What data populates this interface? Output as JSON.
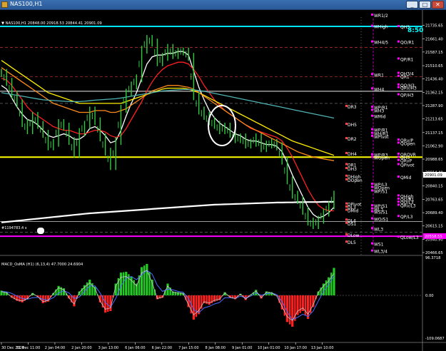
{
  "window": {
    "title": "NAS100,H1",
    "buttons": [
      "_",
      "□",
      "✕"
    ]
  },
  "chart_info": {
    "symbol_line": "▼ NAS100,H1  20848.00 20918.53 20844.41 20901.09",
    "clock": "8:50",
    "macd_label": "MACD_OsMA (H1) (6,13,4)  47.7000 24.6904",
    "chart_note": "#1194783.4 s"
  },
  "price_scale": [
    {
      "label": "21735.65",
      "price": 21735.65
    },
    {
      "label": "21661.40",
      "price": 21661.4
    },
    {
      "label": "21587.15",
      "price": 21587.15
    },
    {
      "label": "21510.65",
      "price": 21510.65
    },
    {
      "label": "21436.40",
      "price": 21436.4
    },
    {
      "label": "21362.15",
      "price": 21362.15
    },
    {
      "label": "21287.90",
      "price": 21287.9
    },
    {
      "label": "21213.65",
      "price": 21213.65
    },
    {
      "label": "21137.15",
      "price": 21137.15
    },
    {
      "label": "21062.90",
      "price": 21062.9
    },
    {
      "label": "20988.65",
      "price": 20988.65
    },
    {
      "label": "20914.40",
      "price": 20914.4
    },
    {
      "label": "20840.15",
      "price": 20840.15
    },
    {
      "label": "20763.65",
      "price": 20763.65
    },
    {
      "label": "20689.40",
      "price": 20689.4
    },
    {
      "label": "20615.15",
      "price": 20615.15
    },
    {
      "label": "20540.90",
      "price": 20540.9
    },
    {
      "label": "20466.65",
      "price": 20466.65
    }
  ],
  "price_badges": [
    {
      "label": "20901.09",
      "price": 20901.09,
      "color": "#ffffff",
      "text_color": "#000000"
    },
    {
      "label": "20558.55",
      "price": 20558.55,
      "color": "#ff00ff",
      "text_color": "#ffffff"
    }
  ],
  "macd_scale": [
    {
      "label": "96.3718",
      "value": 96.3718
    },
    {
      "label": "0.00",
      "value": 0
    },
    {
      "label": "-109.0687",
      "value": -109.0687
    }
  ],
  "time_labels": [
    "30 Dec 2024",
    "31 Dec 11:00",
    "2 Jan 04:00",
    "2 Jan 20:00",
    "3 Jan 13:00",
    "6 Jan 06:00",
    "6 Jan 22:00",
    "7 Jan 15:00",
    "8 Jan 08:00",
    "9 Jan 01:00",
    "10 Jan 01:00",
    "10 Jan 17:00",
    "13 Jan 10:00"
  ],
  "level_labels_left": [
    {
      "text": "DR3",
      "price": 21280,
      "color": "#ffffff"
    },
    {
      "text": "DH5",
      "price": 21180,
      "color": "#ffffff"
    },
    {
      "text": "DR2",
      "price": 21100,
      "color": "#ffffff"
    },
    {
      "text": "DH4",
      "price": 21017,
      "color": "#ffffff"
    },
    {
      "text": "DR1",
      "price": 20955,
      "color": "#ffffff"
    },
    {
      "text": "DH3",
      "price": 20933,
      "color": "#ffffff"
    },
    {
      "text": "DHigh",
      "price": 20890,
      "color": "#ffffff"
    },
    {
      "text": "DOpen",
      "price": 20870,
      "color": "#ffffff"
    },
    {
      "text": "DPivot",
      "price": 20735,
      "color": "#ffffff"
    },
    {
      "text": "DL3",
      "price": 20718,
      "color": "#ffffff"
    },
    {
      "text": "DMid",
      "price": 20700,
      "color": "#ffffff"
    },
    {
      "text": "DL4",
      "price": 20645,
      "color": "#ffffff"
    },
    {
      "text": "DS1",
      "price": 20627,
      "color": "#ffffff"
    },
    {
      "text": "DLow",
      "price": 20563,
      "color": "#ffffff"
    },
    {
      "text": "DL5",
      "price": 20522,
      "color": "#ffffff"
    }
  ],
  "level_labels_mid": [
    {
      "text": "WR1/2",
      "price": 21790,
      "color": "#ffffff"
    },
    {
      "text": "WHigh",
      "price": 21728,
      "color": "#ffffff"
    },
    {
      "text": "WH4/5",
      "price": 21640,
      "color": "#ffffff"
    },
    {
      "text": "WR1",
      "price": 21458,
      "color": "#ffffff"
    },
    {
      "text": "WH4",
      "price": 21378,
      "color": "#ffffff"
    },
    {
      "text": "WP/R1",
      "price": 21275,
      "color": "#ffffff"
    },
    {
      "text": "WH3",
      "price": 21258,
      "color": "#ffffff"
    },
    {
      "text": "WMid",
      "price": 21225,
      "color": "#ffffff"
    },
    {
      "text": "WP/R1",
      "price": 21150,
      "color": "#ffffff"
    },
    {
      "text": "WH/R1",
      "price": 21130,
      "color": "#ffffff"
    },
    {
      "text": "WPivot",
      "price": 21113,
      "color": "#ffffff"
    },
    {
      "text": "WP/R3",
      "price": 21010,
      "color": "#ffffff"
    },
    {
      "text": "WOpen",
      "price": 20995,
      "color": "#ffffff"
    },
    {
      "text": "WP/L3",
      "price": 20845,
      "color": "#ffffff"
    },
    {
      "text": "WOpen",
      "price": 20828,
      "color": "#ffffff"
    },
    {
      "text": "WP/S1",
      "price": 20808,
      "color": "#ffffff"
    },
    {
      "text": "WP/S1",
      "price": 20725,
      "color": "#ffffff"
    },
    {
      "text": "WL3",
      "price": 20708,
      "color": "#ffffff"
    },
    {
      "text": "WS/S1",
      "price": 20692,
      "color": "#ffffff"
    },
    {
      "text": "WO/S1",
      "price": 20652,
      "color": "#ffffff"
    },
    {
      "text": "WL3",
      "price": 20597,
      "color": "#ffffff"
    },
    {
      "text": "WS1",
      "price": 20512,
      "color": "#ffffff"
    },
    {
      "text": "WL3/4",
      "price": 20472,
      "color": "#ffffff"
    }
  ],
  "level_labels_right": [
    {
      "text": "QH3",
      "price": 21726,
      "color": "#ffffff"
    },
    {
      "text": "QO/R1",
      "price": 21640,
      "color": "#ffffff"
    },
    {
      "text": "QP/R1",
      "price": 21545,
      "color": "#ffffff"
    },
    {
      "text": "QH3/4",
      "price": 21465,
      "color": "#ffffff"
    },
    {
      "text": "QR1",
      "price": 21448,
      "color": "#ffffff"
    },
    {
      "text": "QO/H3",
      "price": 21400,
      "color": "#ffffff"
    },
    {
      "text": "QRv/H3",
      "price": 21385,
      "color": "#ffffff"
    },
    {
      "text": "QP/H3",
      "price": 21345,
      "color": "#ffffff"
    },
    {
      "text": "QRv/P",
      "price": 21092,
      "color": "#ffffff"
    },
    {
      "text": "QOpen",
      "price": 21075,
      "color": "#ffffff"
    },
    {
      "text": "QROVR",
      "price": 21013,
      "color": "#ffffff"
    },
    {
      "text": "QH3",
      "price": 20996,
      "color": "#ffffff"
    },
    {
      "text": "QRvP",
      "price": 20978,
      "color": "#ffffff"
    },
    {
      "text": "QPivot",
      "price": 20955,
      "color": "#ffffff"
    },
    {
      "text": "QMid",
      "price": 20885,
      "color": "#ffffff"
    },
    {
      "text": "QHigh",
      "price": 20780,
      "color": "#ffffff"
    },
    {
      "text": "QO/R1",
      "price": 20762,
      "color": "#ffffff"
    },
    {
      "text": "QO/L3",
      "price": 20745,
      "color": "#ffffff"
    },
    {
      "text": "QRv/L3",
      "price": 20728,
      "color": "#ffffff"
    },
    {
      "text": "QP/L3",
      "price": 20665,
      "color": "#ffffff"
    },
    {
      "text": "QLow/L3",
      "price": 20550,
      "color": "#ffffff"
    }
  ],
  "horizontal_lines": [
    {
      "name": "cyan-line",
      "price": 21730,
      "color": "#00e5ff",
      "style": "solid",
      "width": 2
    },
    {
      "name": "magenta-line",
      "price": 20558,
      "color": "#ff00ff",
      "style": "solid",
      "width": 2
    },
    {
      "name": "yellow-line",
      "price": 21000,
      "color": "#ffff00",
      "style": "solid",
      "width": 2
    },
    {
      "name": "gray-line-1",
      "price": 21368,
      "color": "#9e9e9e",
      "style": "solid",
      "width": 1.5
    },
    {
      "name": "gray-line-2",
      "price": 20640,
      "color": "#9e9e9e",
      "style": "solid",
      "width": 1
    },
    {
      "name": "red-dash-1",
      "price": 21612,
      "color": "#d03030",
      "style": "dash",
      "width": 0.7
    },
    {
      "name": "red-dash-2",
      "price": 21450,
      "color": "#d03030",
      "style": "dash",
      "width": 0.7
    },
    {
      "name": "gray-dash-1",
      "price": 21300,
      "color": "#808080",
      "style": "dash",
      "width": 0.6
    },
    {
      "name": "gray-dash-2",
      "price": 20580,
      "color": "#808080",
      "style": "dash",
      "width": 0.6
    }
  ],
  "chart_data": {
    "type": "line",
    "price_series": [
      {
        "name": "close",
        "color": "#2ecc40",
        "values": [
          21470,
          21420,
          21350,
          21300,
          21190,
          21150,
          21230,
          21180,
          21130,
          21060,
          21080,
          21190,
          21170,
          21090,
          21020,
          21140,
          21180,
          21260,
          21200,
          21110,
          21030,
          20950,
          21090,
          21270,
          21360,
          21400,
          21440,
          21600,
          21660,
          21640,
          21530,
          21560,
          21610,
          21570,
          21590,
          21590,
          21560,
          21340,
          21260,
          21230,
          21200,
          21180,
          21150,
          21170,
          21130,
          21100,
          21110,
          21070,
          21080,
          21110,
          21050,
          21070,
          21080,
          21060,
          20980,
          20870,
          20790,
          20760,
          20700,
          20640,
          20620,
          20650,
          20690,
          20730,
          20790
        ]
      },
      {
        "name": "white-ma",
        "color": "#ffffff",
        "values": [
          21400,
          21380,
          21330,
          21280,
          21240,
          21210,
          21200,
          21180,
          21150,
          21120,
          21110,
          21120,
          21130,
          21120,
          21100,
          21100,
          21120,
          21160,
          21170,
          21150,
          21120,
          21080,
          21090,
          21150,
          21230,
          21300,
          21360,
          21440,
          21520,
          21560,
          21570,
          21570,
          21580,
          21580,
          21590,
          21590,
          21570,
          21480,
          21390,
          21320,
          21260,
          21220,
          21190,
          21170,
          21150,
          21130,
          21120,
          21100,
          21090,
          21090,
          21080,
          21070,
          21070,
          21060,
          21030,
          20970,
          20900,
          20840,
          20780,
          20720,
          20680,
          20660,
          20670,
          20690,
          20720
        ]
      },
      {
        "name": "red-ma",
        "color": "#ff2020",
        "values": [
          21440,
          21430,
          21400,
          21360,
          21320,
          21280,
          21250,
          21230,
          21210,
          21190,
          21170,
          21160,
          21150,
          21150,
          21140,
          21130,
          21130,
          21140,
          21150,
          21150,
          21140,
          21120,
          21110,
          21120,
          21160,
          21210,
          21260,
          21310,
          21370,
          21420,
          21460,
          21490,
          21510,
          21520,
          21530,
          21530,
          21520,
          21490,
          21450,
          21400,
          21360,
          21320,
          21290,
          21260,
          21240,
          21220,
          21200,
          21180,
          21160,
          21150,
          21140,
          21130,
          21120,
          21110,
          21090,
          21050,
          21000,
          20940,
          20880,
          20820,
          20770,
          20730,
          20710,
          20700,
          20700
        ]
      },
      {
        "name": "yellow-ma",
        "color": "#ffee00",
        "values": [
          21540,
          21520,
          21500,
          21480,
          21460,
          21440,
          21420,
          21400,
          21380,
          21360,
          21350,
          21340,
          21330,
          21320,
          21310,
          21300,
          21300,
          21300,
          21300,
          21300,
          21300,
          21300,
          21300,
          21300,
          21310,
          21320,
          21330,
          21340,
          21350,
          21360,
          21370,
          21380,
          21385,
          21385,
          21385,
          21385,
          21380,
          21370,
          21360,
          21345,
          21330,
          21315,
          21300,
          21285,
          21270,
          21255,
          21240,
          21225,
          21210,
          21195,
          21180,
          21165,
          21150,
          21135,
          21120,
          21105,
          21090,
          21080,
          21070,
          21060,
          21050,
          21040,
          21030,
          21020,
          21010
        ]
      },
      {
        "name": "orange-ma",
        "color": "#ff8c1a",
        "values": [
          21500,
          21480,
          21460,
          21440,
          21420,
          21400,
          21380,
          21360,
          21340,
          21320,
          21300,
          21290,
          21280,
          21270,
          21260,
          21250,
          21250,
          21250,
          21260,
          21260,
          21260,
          21250,
          21250,
          21260,
          21270,
          21290,
          21310,
          21330,
          21350,
          21370,
          21380,
          21390,
          21400,
          21400,
          21400,
          21395,
          21390,
          21380,
          21360,
          21340,
          21320,
          21300,
          21280,
          21260,
          21240,
          21220,
          21200,
          21180,
          21165,
          21150,
          21135,
          21120,
          21105,
          21090,
          21075,
          21060,
          21045,
          21030,
          21020,
          21010,
          21000,
          20995,
          20990,
          20985,
          20980
        ]
      },
      {
        "name": "teal-ma",
        "color": "#4fb3b3",
        "values": [
          21360,
          21355,
          21350,
          21345,
          21340,
          21335,
          21330,
          21325,
          21320,
          21318,
          21316,
          21314,
          21312,
          21310,
          21310,
          21310,
          21312,
          21315,
          21318,
          21320,
          21322,
          21324,
          21326,
          21330,
          21335,
          21340,
          21345,
          21350,
          21355,
          21360,
          21365,
          21370,
          21372,
          21374,
          21376,
          21378,
          21378,
          21376,
          21372,
          21368,
          21362,
          21356,
          21350,
          21344,
          21338,
          21332,
          21326,
          21320,
          21314,
          21308,
          21302,
          21296,
          21290,
          21284,
          21278,
          21272,
          21266,
          21260,
          21254,
          21248,
          21242,
          21236,
          21230,
          21224,
          21218
        ]
      },
      {
        "name": "white-long-ma",
        "color": "#ffffff",
        "values": [
          20635,
          20638,
          20641,
          20644,
          20647,
          20650,
          20653,
          20656,
          20659,
          20662,
          20665,
          20668,
          20671,
          20674,
          20677,
          20680,
          20683,
          20686,
          20688,
          20690,
          20692,
          20694,
          20696,
          20698,
          20700,
          20702,
          20704,
          20706,
          20708,
          20710,
          20712,
          20714,
          20716,
          20718,
          20720,
          20722,
          20724,
          20726,
          20728,
          20730,
          20732,
          20734,
          20735,
          20736,
          20737,
          20738,
          20739,
          20740,
          20741,
          20742,
          20743,
          20744,
          20745,
          20746,
          20746,
          20747,
          20747,
          20748,
          20748,
          20749,
          20749,
          20749,
          20750,
          20750,
          20750
        ]
      }
    ],
    "macd_histogram": [
      12,
      8,
      -6,
      -14,
      -18,
      -10,
      6,
      -4,
      -20,
      -16,
      6,
      24,
      18,
      -8,
      -28,
      10,
      26,
      40,
      22,
      -18,
      -44,
      -40,
      30,
      58,
      60,
      48,
      30,
      72,
      80,
      40,
      -10,
      -6,
      30,
      10,
      8,
      6,
      -30,
      -62,
      -48,
      -20,
      -24,
      -16,
      -12,
      8,
      -6,
      -10,
      4,
      -12,
      2,
      14,
      -8,
      10,
      8,
      -2,
      -36,
      -68,
      -80,
      -50,
      -40,
      -60,
      -30,
      10,
      30,
      46,
      70
    ],
    "macd_signal": [
      10,
      9,
      5,
      -2,
      -8,
      -10,
      -6,
      -5,
      -10,
      -12,
      -6,
      6,
      12,
      6,
      -8,
      -4,
      10,
      24,
      24,
      6,
      -18,
      -30,
      -8,
      24,
      44,
      48,
      40,
      52,
      64,
      54,
      26,
      10,
      16,
      14,
      10,
      8,
      -8,
      -36,
      -44,
      -32,
      -28,
      -22,
      -18,
      -6,
      -6,
      -8,
      -2,
      -6,
      -2,
      6,
      0,
      4,
      6,
      2,
      -16,
      -42,
      -62,
      -56,
      -48,
      -54,
      -40,
      -14,
      10,
      28,
      50
    ],
    "xlabels": [
      "30 Dec 2024",
      "31 Dec 11:00",
      "2 Jan 04:00",
      "2 Jan 20:00",
      "3 Jan 13:00",
      "6 Jan 06:00",
      "6 Jan 22:00",
      "7 Jan 15:00",
      "8 Jan 08:00",
      "9 Jan 01:00",
      "10 Jan 01:00",
      "10 Jan 17:00",
      "13 Jan 10:00"
    ],
    "price_ylim": [
      20466.65,
      21790
    ],
    "macd_ylim": [
      -109.0687,
      96.3718
    ],
    "grid": false
  },
  "colors": {
    "background": "#000000",
    "bull_bar": "#2ecc40",
    "hist_up": "#22cc22",
    "hist_down": "#ff2020",
    "axis_text": "#ffffff"
  }
}
